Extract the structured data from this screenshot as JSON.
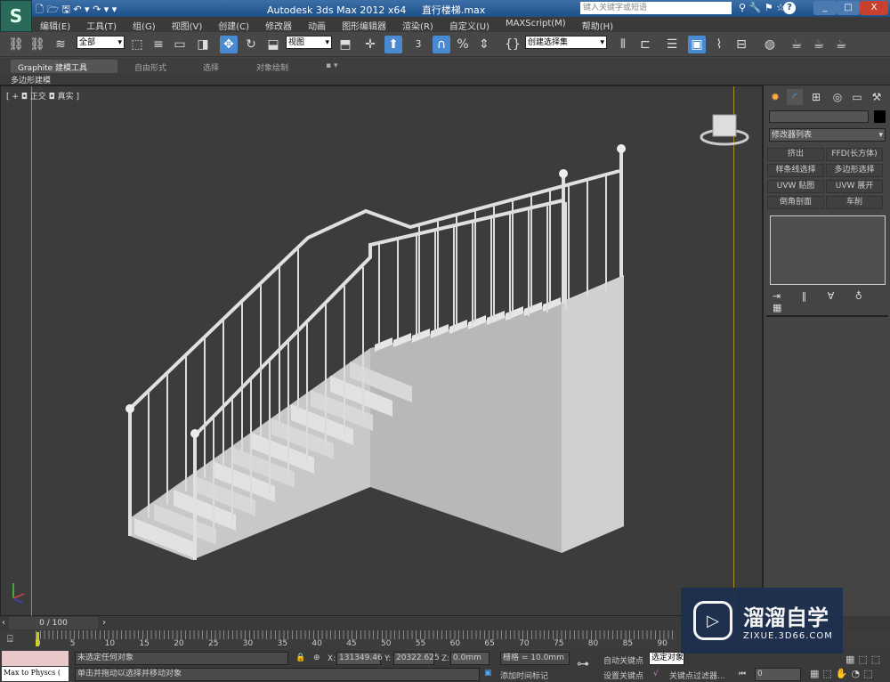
{
  "titlebar": {
    "app": "Autodesk 3ds Max  2012 x64",
    "file": "直行楼梯.max",
    "search_placeholder": "键入关键字或短语",
    "help": "?",
    "minimize": "_",
    "maximize": "□",
    "close": "X"
  },
  "logo": "S",
  "menu": [
    "编辑(E)",
    "工具(T)",
    "组(G)",
    "视图(V)",
    "创建(C)",
    "修改器",
    "动画",
    "图形编辑器",
    "渲染(R)",
    "自定义(U)",
    "MAXScript(M)",
    "帮助(H)"
  ],
  "toolbar": {
    "selection_filter": "全部",
    "ref_coord": "视图",
    "named_selection": "创建选择集",
    "snap_value": "3"
  },
  "ribbon": {
    "tabs": [
      "Graphite 建模工具",
      "自由形式",
      "选择",
      "对象绘制"
    ],
    "active": 0,
    "subtab": "多边形建模"
  },
  "viewport": {
    "label_parts": [
      "[ + ",
      "◘ 正交",
      "◘ 真实 ]"
    ]
  },
  "panel": {
    "modifier_list": "修改器列表",
    "buttons": [
      "挤出",
      "FFD(长方体)",
      "样条线选择",
      "多边形选择",
      "UVW 贴图",
      "UVW 展开",
      "倒角剖面",
      "车削"
    ]
  },
  "timeline": {
    "frame": "0 / 100",
    "ticks": [
      "0",
      "5",
      "10",
      "15",
      "20",
      "25",
      "30",
      "35",
      "40",
      "45",
      "50",
      "55",
      "60",
      "65",
      "70",
      "75",
      "80",
      "85",
      "90"
    ]
  },
  "status": {
    "script_listener": "Max to Physcs (",
    "selection": "未选定任何对象",
    "prompt": "单击并拖动以选择并移动对象",
    "x_label": "X:",
    "x": "131349.46",
    "y_label": "Y:",
    "y": "20322.625",
    "z_label": "Z:",
    "z": "0.0mm",
    "grid": "栅格 = 10.0mm",
    "add_time_tag": "添加时间标记",
    "auto_key": "自动关键点",
    "selected": "选定对象",
    "set_key": "设置关键点",
    "key_filters": "关键点过滤器...",
    "current_frame": "0"
  },
  "watermark": {
    "brand": "溜溜自学",
    "url": "ZIXUE.3D66.COM"
  },
  "colors": {
    "viewport_bg": "#3c3c3c",
    "active_border": "#a09020",
    "accent": "#4a8ad0"
  }
}
